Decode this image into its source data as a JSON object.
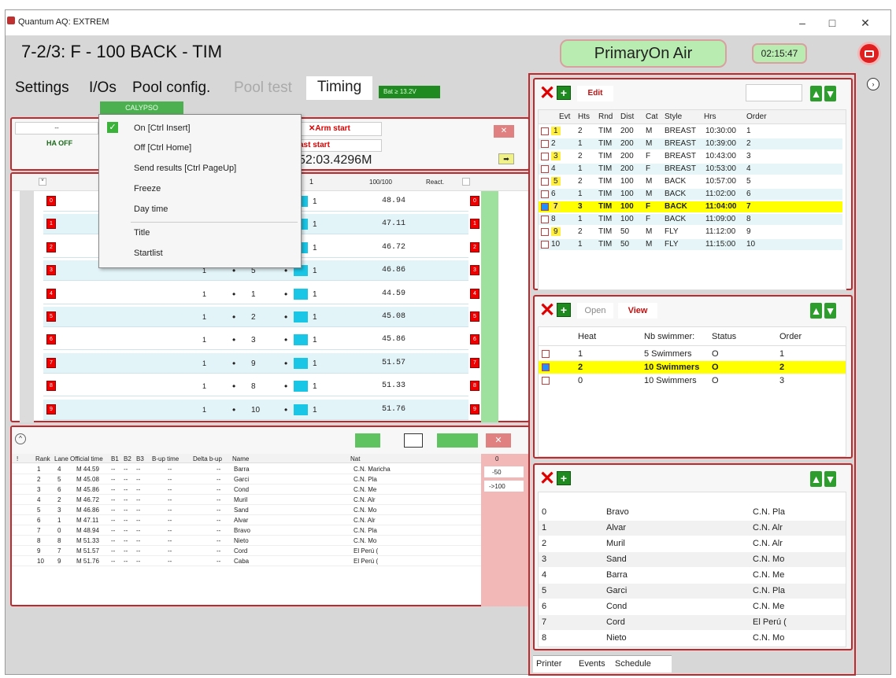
{
  "window": {
    "title": "Quantum AQ: EXTREM",
    "minimize": "–",
    "maximize": "□",
    "close": "✕"
  },
  "header": {
    "race_title": "7-2/3: F - 100 BACK - TIM",
    "air_status": "PrimaryOn Air",
    "clock": "02:15:47"
  },
  "menu": {
    "tabs": [
      "Settings",
      "I/Os",
      "Pool config.",
      "Pool test",
      "Timing"
    ],
    "battery": "Bat ≥ 13.2V",
    "calypso": "CALYPSO"
  },
  "dropdown": {
    "items": [
      "On [Ctrl Insert]",
      "Off [Ctrl Home]",
      "Send results [Ctrl PageUp]",
      "Freeze",
      "Day time",
      "Title",
      "Startlist"
    ]
  },
  "timing": {
    "arm_start": "Arm start",
    "last_start": "ast start",
    "last_start_time": "52:03.4296M",
    "ha_off": "HA OFF",
    "dash": "--",
    "arrow": "➡",
    "col_one": "1",
    "col_hundred": "100/100",
    "col_react": "React."
  },
  "lanes": [
    {
      "lane": "0",
      "n": "",
      "time": "48.94"
    },
    {
      "lane": "1",
      "n": "",
      "time": "47.11"
    },
    {
      "lane": "2",
      "n": "",
      "time": "46.72"
    },
    {
      "lane": "3",
      "n": "5",
      "time": "46.86"
    },
    {
      "lane": "4",
      "n": "1",
      "time": "44.59"
    },
    {
      "lane": "5",
      "n": "2",
      "time": "45.08"
    },
    {
      "lane": "6",
      "n": "3",
      "time": "45.86"
    },
    {
      "lane": "7",
      "n": "9",
      "time": "51.57"
    },
    {
      "lane": "8",
      "n": "8",
      "time": "51.33"
    },
    {
      "lane": "9",
      "n": "10",
      "time": "51.76"
    }
  ],
  "results": {
    "headers": [
      "!",
      "Rank",
      "Lane",
      "Official time",
      "B1",
      "B2",
      "B3",
      "B-up time",
      "Delta b-up",
      "Name",
      "Nat"
    ],
    "rows": [
      [
        "1",
        "4",
        "M 44.59",
        "Barra",
        "C.N. Maricha"
      ],
      [
        "2",
        "5",
        "M 45.08",
        "Garci",
        "C.N. Pla"
      ],
      [
        "3",
        "6",
        "M 45.86",
        "Cond",
        "C.N. Me"
      ],
      [
        "4",
        "2",
        "M 46.72",
        "Muril",
        "C.N. Alr"
      ],
      [
        "5",
        "3",
        "M 46.86",
        "Sand",
        "C.N. Mo"
      ],
      [
        "6",
        "1",
        "M 47.11",
        "Alvar",
        "C.N. Alr"
      ],
      [
        "7",
        "0",
        "M 48.94",
        "Bravo",
        "C.N. Pla"
      ],
      [
        "8",
        "8",
        "M 51.33",
        "Nieto",
        "C.N. Mo"
      ],
      [
        "9",
        "7",
        "M 51.57",
        "Cord",
        "El Perú ("
      ],
      [
        "10",
        "9",
        "M 51.76",
        "Caba",
        "El Perú ("
      ]
    ],
    "side": [
      "0",
      "-50",
      "->100"
    ]
  },
  "events": {
    "edit": "Edit",
    "headers": [
      "Evt",
      "Hts",
      "Rnd",
      "Dist",
      "Cat",
      "Style",
      "Hrs",
      "Order"
    ],
    "rows": [
      [
        "1",
        "2",
        "TIM",
        "200",
        "M",
        "BREAST",
        "10:30:00",
        "1"
      ],
      [
        "2",
        "1",
        "TIM",
        "200",
        "M",
        "BREAST",
        "10:39:00",
        "2"
      ],
      [
        "3",
        "2",
        "TIM",
        "200",
        "F",
        "BREAST",
        "10:43:00",
        "3"
      ],
      [
        "4",
        "1",
        "TIM",
        "200",
        "F",
        "BREAST",
        "10:53:00",
        "4"
      ],
      [
        "5",
        "2",
        "TIM",
        "100",
        "M",
        "BACK",
        "10:57:00",
        "5"
      ],
      [
        "6",
        "1",
        "TIM",
        "100",
        "M",
        "BACK",
        "11:02:00",
        "6"
      ],
      [
        "7",
        "3",
        "TIM",
        "100",
        "F",
        "BACK",
        "11:04:00",
        "7"
      ],
      [
        "8",
        "1",
        "TIM",
        "100",
        "F",
        "BACK",
        "11:09:00",
        "8"
      ],
      [
        "9",
        "2",
        "TIM",
        "50",
        "M",
        "FLY",
        "11:12:00",
        "9"
      ],
      [
        "10",
        "1",
        "TIM",
        "50",
        "M",
        "FLY",
        "11:15:00",
        "10"
      ]
    ]
  },
  "heats": {
    "open": "Open",
    "view": "View",
    "headers": [
      "Heat",
      "Nb swimmer:",
      "Status",
      "Order"
    ],
    "rows": [
      [
        "1",
        "5 Swimmers",
        "O",
        "1"
      ],
      [
        "2",
        "10 Swimmers",
        "O",
        "2"
      ],
      [
        "0",
        "10 Swimmers",
        "O",
        "3"
      ]
    ]
  },
  "swimmers": {
    "rows": [
      [
        "0",
        "Bravo",
        "C.N. Pla"
      ],
      [
        "1",
        "Alvar",
        "C.N. Alr"
      ],
      [
        "2",
        "Muril",
        "C.N. Alr"
      ],
      [
        "3",
        "Sand",
        "C.N. Mo"
      ],
      [
        "4",
        "Barra",
        "C.N. Me"
      ],
      [
        "5",
        "Garci",
        "C.N. Pla"
      ],
      [
        "6",
        "Cond",
        "C.N. Me"
      ],
      [
        "7",
        "Cord",
        "El Perú ("
      ],
      [
        "8",
        "Nieto",
        "C.N. Mo"
      ]
    ]
  },
  "bottom_tabs": [
    "Printer",
    "Events",
    "Schedule"
  ],
  "colors": {
    "accent_red": "#c0282c",
    "highlight_yellow": "#ffff00",
    "air_green": "#b8ecb0",
    "row_cyan": "#dff3f7"
  }
}
